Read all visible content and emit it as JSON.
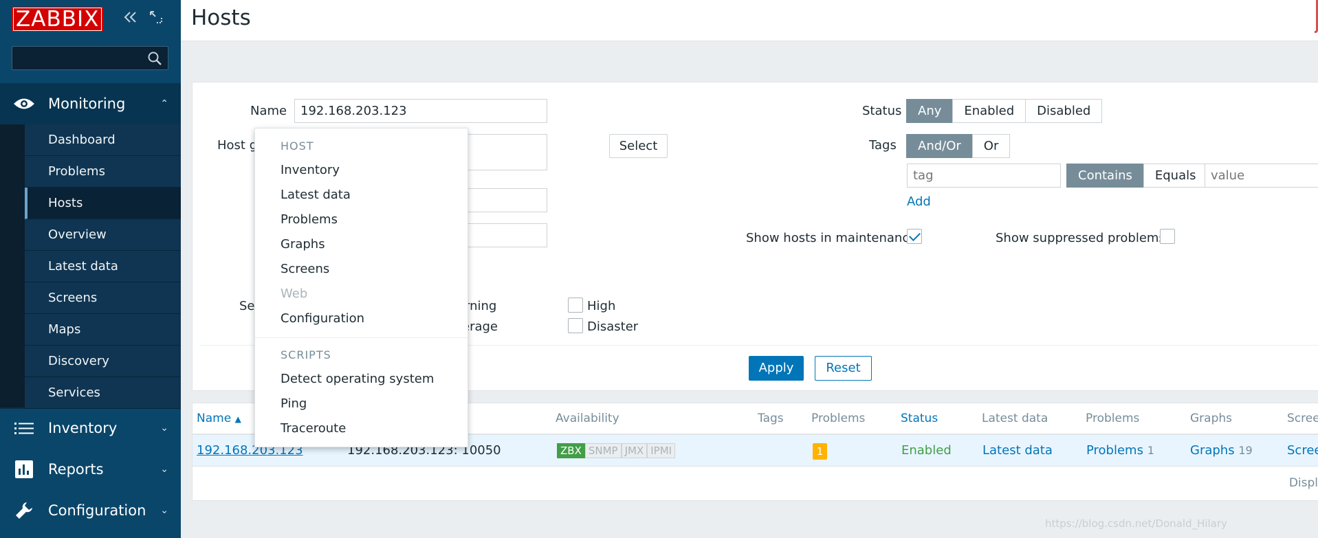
{
  "sidebar": {
    "logo": "ZABBIX",
    "sections": {
      "monitoring": "Monitoring",
      "inventory": "Inventory",
      "reports": "Reports",
      "configuration": "Configuration"
    },
    "submenu": [
      "Dashboard",
      "Problems",
      "Hosts",
      "Overview",
      "Latest data",
      "Screens",
      "Maps",
      "Discovery",
      "Services"
    ]
  },
  "header": {
    "title": "Hosts"
  },
  "filter": {
    "name_label": "Name",
    "name_value": "192.168.203.123",
    "host_groups_label_partial": "Host g",
    "select_button": "Select",
    "severity_label_partial": "Se",
    "severity_partial_warning": "rning",
    "severity_partial_average": "erage",
    "severity_high": "High",
    "severity_disaster": "Disaster",
    "status_label": "Status",
    "status_options": [
      "Any",
      "Enabled",
      "Disabled"
    ],
    "tags_label": "Tags",
    "tags_options": [
      "And/Or",
      "Or"
    ],
    "tag_placeholder": "tag",
    "tag_operators": [
      "Contains",
      "Equals"
    ],
    "value_placeholder": "value",
    "add_link": "Add",
    "maintenance_label": "Show hosts in maintenance",
    "suppressed_label": "Show suppressed problems",
    "apply": "Apply",
    "reset": "Reset"
  },
  "table": {
    "headers": {
      "name": "Name",
      "availability": "Availability",
      "tags": "Tags",
      "problems": "Problems",
      "status": "Status",
      "latest_data": "Latest data",
      "problems2": "Problems",
      "graphs": "Graphs",
      "screens_partial": "Scree"
    },
    "row": {
      "name": "192.168.203.123",
      "interface_partial": "192.168.203.123: 10050",
      "availability": [
        "ZBX",
        "SNMP",
        "JMX",
        "IPMI"
      ],
      "problems_count": "1",
      "status": "Enabled",
      "latest_data": "Latest data",
      "problems_link": "Problems",
      "problems_num": "1",
      "graphs_link": "Graphs",
      "graphs_num": "19",
      "screens_partial": "Scree"
    },
    "display_partial": "Displ"
  },
  "context_menu": {
    "host_header": "HOST",
    "host_items": [
      "Inventory",
      "Latest data",
      "Problems",
      "Graphs",
      "Screens",
      "Web",
      "Configuration"
    ],
    "scripts_header": "SCRIPTS",
    "script_items": [
      "Detect operating system",
      "Ping",
      "Traceroute"
    ]
  },
  "watermark": "https://blog.csdn.net/Donald_Hilary",
  "colors": {
    "sidebar": "#0a466a",
    "accent": "#0275b8",
    "logo": "#d40000",
    "enabled": "#429e47",
    "badge": "#ffb300"
  }
}
